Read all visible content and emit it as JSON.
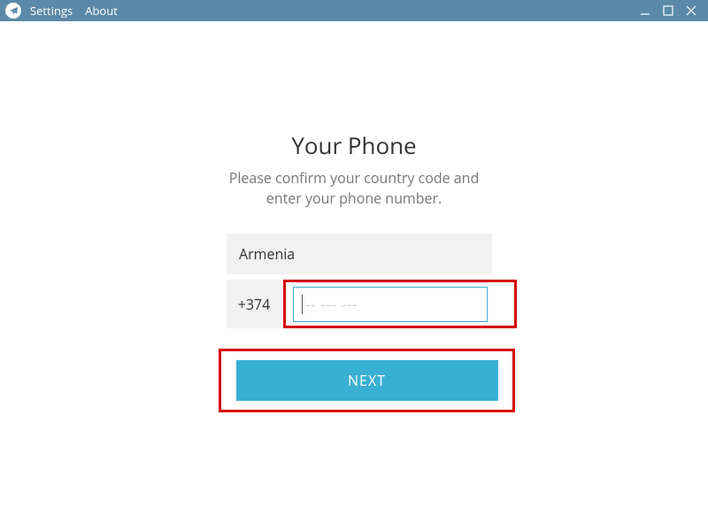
{
  "titlebar": {
    "menu": {
      "settings": "Settings",
      "about": "About"
    }
  },
  "form": {
    "heading": "Your Phone",
    "subtext_line1": "Please confirm your country code and",
    "subtext_line2": "enter your phone number.",
    "country": "Armenia",
    "dial_code": "+374",
    "phone_placeholder": "-- --- ---",
    "next_label": "NEXT"
  },
  "colors": {
    "titlebar_bg": "#5a8aa8",
    "accent": "#39afd3",
    "input_border": "#3bb0d2",
    "highlight": "#d30502"
  }
}
